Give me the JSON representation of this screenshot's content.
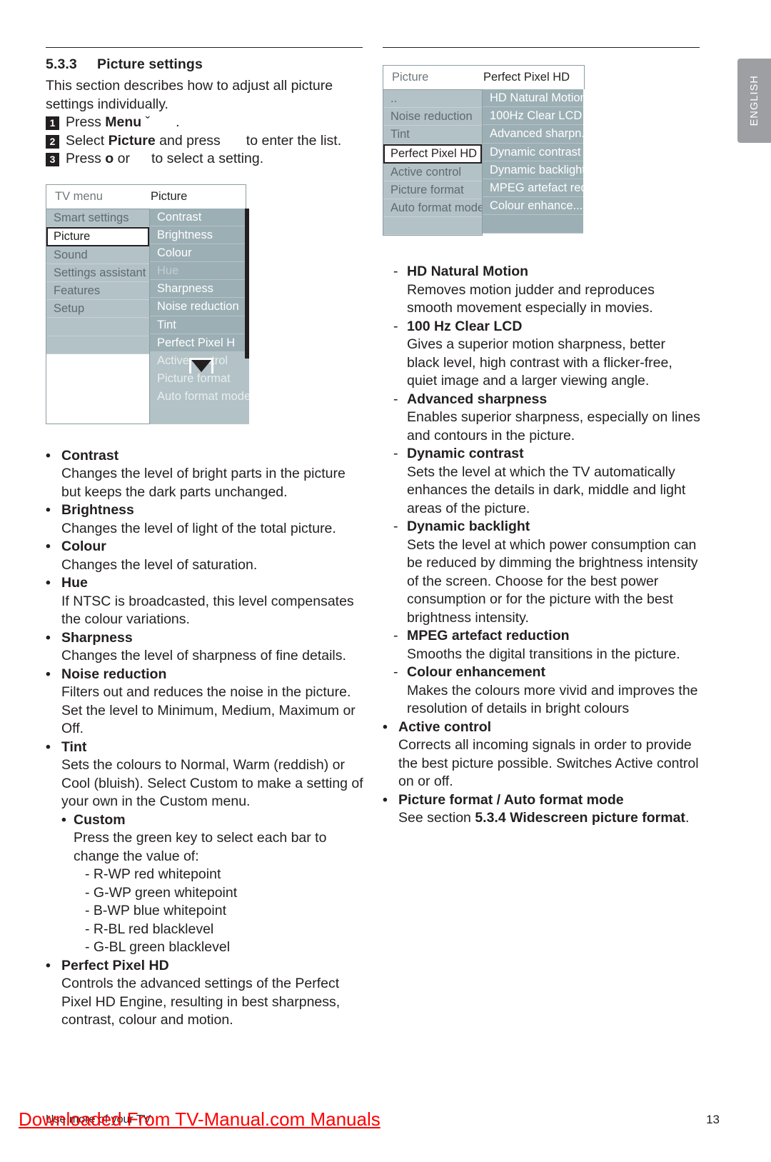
{
  "page": {
    "language_tab": "ENGLISH",
    "page_number": "13",
    "footer_text": "Use more of your TV",
    "watermark": "Downloaded From TV-Manual.com Manuals"
  },
  "left": {
    "section_number": "5.3.3",
    "section_title": "Picture settings",
    "intro": "This section describes how to adjust all picture settings individually.",
    "steps": [
      {
        "num": "1",
        "pre": "Press ",
        "bold": "Menu",
        "mid": " ˇ",
        "post": "."
      },
      {
        "num": "2",
        "pre": "Select ",
        "bold": "Picture",
        "mid": " and press",
        "post": "to enter the list."
      },
      {
        "num": "3",
        "pre": "Press ",
        "bold": "o",
        "mid": " or",
        "post": "to select a setting."
      }
    ],
    "menu": {
      "header_left": "TV menu",
      "header_right": "Picture",
      "left_items": [
        {
          "label": "Smart settings",
          "selected": false
        },
        {
          "label": "Picture",
          "selected": true
        },
        {
          "label": "Sound",
          "selected": false
        },
        {
          "label": "Settings assistant",
          "selected": false
        },
        {
          "label": "Features",
          "selected": false
        },
        {
          "label": "Setup",
          "selected": false
        },
        {
          "label": "",
          "selected": false
        },
        {
          "label": "",
          "selected": false
        }
      ],
      "right_items": [
        {
          "label": "Contrast",
          "state": "normal"
        },
        {
          "label": "Brightness",
          "state": "normal"
        },
        {
          "label": "Colour",
          "state": "normal"
        },
        {
          "label": "Hue",
          "state": "faint"
        },
        {
          "label": "Sharpness",
          "state": "normal"
        },
        {
          "label": "Noise reduction",
          "state": "normal"
        },
        {
          "label": "Tint",
          "state": "normal"
        },
        {
          "label": "Perfect Pixel H",
          "state": "normal"
        },
        {
          "label": "Active control",
          "state": "dim"
        },
        {
          "label": "Picture format",
          "state": "dim"
        },
        {
          "label": "Auto format mode",
          "state": "dim"
        },
        {
          "label": "",
          "state": "dim"
        }
      ]
    },
    "bullets": [
      {
        "head": "Contrast",
        "body": "Changes the level of bright parts in the picture but keeps the dark parts unchanged."
      },
      {
        "head": "Brightness",
        "body": "Changes the level of light of the total picture."
      },
      {
        "head": "Colour",
        "body": "Changes the level of saturation."
      },
      {
        "head": "Hue",
        "body": "If NTSC is broadcasted, this level compensates the colour variations."
      },
      {
        "head": "Sharpness",
        "body": "Changes the level of sharpness of fine details."
      },
      {
        "head": "Noise reduction",
        "body": "Filters out and reduces the noise in the picture. Set the level to Minimum, Medium, Maximum or Off."
      },
      {
        "head": "Tint",
        "body": "Sets the colours to Normal, Warm (reddish) or Cool (bluish). Select Custom to make a setting of your own in the Custom menu."
      }
    ],
    "custom": {
      "head": "Custom",
      "body": "Press the green key to select each bar to change the value of:",
      "values": [
        "- R-WP red whitepoint",
        "- G-WP green whitepoint",
        "- B-WP blue whitepoint",
        "- R-BL red blacklevel",
        "- G-BL green blacklevel"
      ]
    },
    "perfect_pixel": {
      "head": "Perfect Pixel HD",
      "body": "Controls the advanced settings of the Perfect Pixel HD Engine, resulting in best sharpness, contrast, colour and motion."
    }
  },
  "right": {
    "menu": {
      "header_left": "Picture",
      "header_right": "Perfect Pixel HD",
      "left_items": [
        {
          "label": "..",
          "selected": false
        },
        {
          "label": "Noise reduction",
          "selected": false
        },
        {
          "label": "Tint",
          "selected": false
        },
        {
          "label": "Perfect Pixel HD",
          "selected": true
        },
        {
          "label": "Active control",
          "selected": false
        },
        {
          "label": "Picture format",
          "selected": false
        },
        {
          "label": "Auto format mode",
          "selected": false
        },
        {
          "label": "",
          "selected": false
        }
      ],
      "right_items": [
        {
          "label": "HD Natural Motion",
          "state": "normal"
        },
        {
          "label": "100Hz Clear LCD",
          "state": "normal"
        },
        {
          "label": "Advanced sharpn...",
          "state": "normal"
        },
        {
          "label": "Dynamic contrast",
          "state": "normal"
        },
        {
          "label": "Dynamic backlight",
          "state": "normal"
        },
        {
          "label": "MPEG artefact red...",
          "state": "normal"
        },
        {
          "label": "Colour enhance...",
          "state": "normal"
        },
        {
          "label": "",
          "state": "normal"
        }
      ]
    },
    "sub_bullets": [
      {
        "head": "HD Natural Motion",
        "body": "Removes motion judder and reproduces smooth movement especially in movies."
      },
      {
        "head": "100 Hz Clear LCD",
        "body": "Gives a superior motion sharpness, better black level, high contrast with a flicker-free, quiet image and a larger viewing angle."
      },
      {
        "head": "Advanced sharpness",
        "body": "Enables superior sharpness, especially on lines and contours in the picture."
      },
      {
        "head": "Dynamic contrast",
        "body": "Sets the level at which the TV automatically enhances the details in dark, middle and light areas of the picture."
      },
      {
        "head": "Dynamic backlight",
        "body": "Sets the level at which power consumption can be reduced by dimming the brightness intensity of the screen. Choose for the best power consumption or for the picture with the best brightness intensity."
      },
      {
        "head": "MPEG artefact reduction",
        "body": "Smooths the digital transitions in the picture."
      },
      {
        "head": "Colour enhancement",
        "body": "Makes the colours more vivid and improves the resolution of details in bright colours"
      }
    ],
    "bullets": [
      {
        "head": "Active control",
        "body": "Corrects all incoming signals in order to provide the best picture possible. Switches Active control on or off."
      }
    ],
    "last_bullet": {
      "head": "Picture format / Auto format mode",
      "body_pre": "See section ",
      "body_bold": "5.3.4 Widescreen picture format",
      "body_post": "."
    }
  }
}
